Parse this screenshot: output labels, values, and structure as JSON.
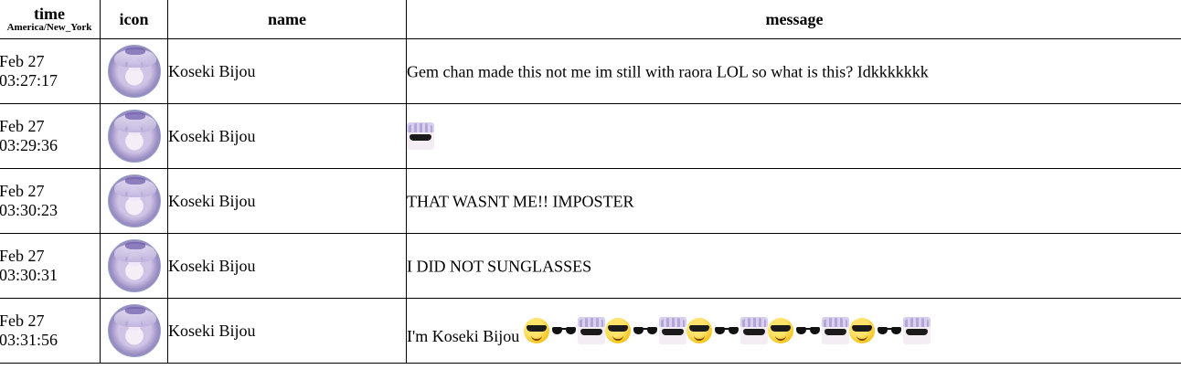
{
  "table": {
    "headers": {
      "time": "time",
      "timezone": "America/New_York",
      "icon": "icon",
      "name": "name",
      "message": "message"
    },
    "rows": [
      {
        "date": "Feb 27",
        "time": "03:27:17",
        "avatar": "koseki-bijou-avatar",
        "name": "Koseki Bijou",
        "message": "Gem chan made this not me im still with raora LOL so what is this? Idkkkkkkk"
      },
      {
        "date": "Feb 27",
        "time": "03:29:36",
        "avatar": "koseki-bijou-avatar",
        "name": "Koseki Bijou",
        "message": "",
        "emotes": [
          "bijou-sunglasses-emote"
        ]
      },
      {
        "date": "Feb 27",
        "time": "03:30:23",
        "avatar": "koseki-bijou-avatar",
        "name": "Koseki Bijou",
        "message": "THAT WASNT ME!! IMPOSTER"
      },
      {
        "date": "Feb 27",
        "time": "03:30:31",
        "avatar": "koseki-bijou-avatar",
        "name": "Koseki Bijou",
        "message": "I DID NOT SUNGLASSES"
      },
      {
        "date": "Feb 27",
        "time": "03:31:56",
        "avatar": "koseki-bijou-avatar",
        "name": "Koseki Bijou",
        "message": "I'm Koseki Bijou",
        "emotes": [
          "smiling-face-with-sunglasses-emoji",
          "sunglasses-emoji",
          "bijou-sunglasses-emote",
          "smiling-face-with-sunglasses-emoji",
          "sunglasses-emoji",
          "bijou-sunglasses-emote",
          "smiling-face-with-sunglasses-emoji",
          "sunglasses-emoji",
          "bijou-sunglasses-emote",
          "smiling-face-with-sunglasses-emoji",
          "sunglasses-emoji",
          "bijou-sunglasses-emote",
          "smiling-face-with-sunglasses-emoji",
          "sunglasses-emoji",
          "bijou-sunglasses-emote"
        ]
      }
    ]
  }
}
